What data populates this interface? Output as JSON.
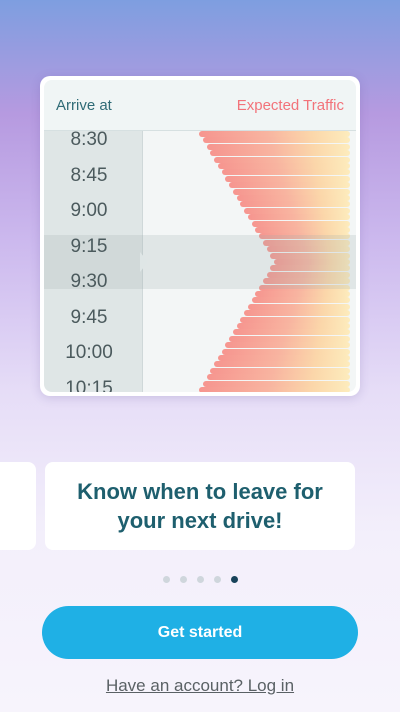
{
  "preview_card": {
    "left_header": "Arrive at",
    "right_header": "Expected Traffic",
    "times": [
      "8:30",
      "8:45",
      "9:00",
      "9:15",
      "9:30",
      "9:45",
      "10:00",
      "10:15"
    ],
    "highlighted_range": [
      "9:15",
      "9:30"
    ]
  },
  "onboarding": {
    "message": "Know when to leave for your next drive!",
    "page_count": 5,
    "active_page": 5
  },
  "cta": {
    "label": "Get started"
  },
  "login_link": {
    "label": "Have an account? Log in"
  },
  "colors": {
    "accent": "#1fb0e5",
    "headline": "#1e5f6e",
    "traffic_label": "#f2737a",
    "active_dot": "#18435a"
  }
}
